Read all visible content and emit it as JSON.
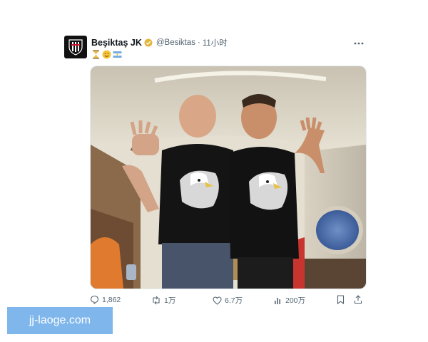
{
  "tweet": {
    "display_name": "Beşiktaş JK",
    "handle": "@Besiktas",
    "separator": "·",
    "time": "11小时",
    "more_icon": "more-horizontal-icon",
    "emojis": [
      "hourglass-emoji",
      "smiling-face-emoji",
      "flag-emoji"
    ],
    "verified_color": "#e2b53e",
    "photo_description_icon": "photo",
    "actions": {
      "reply_count": "1,862",
      "retweet_count": "1万",
      "like_count": "6.7万",
      "view_count": "200万"
    }
  },
  "watermark": {
    "text": "jj-laoge.com",
    "color": "#7fb6ec"
  }
}
